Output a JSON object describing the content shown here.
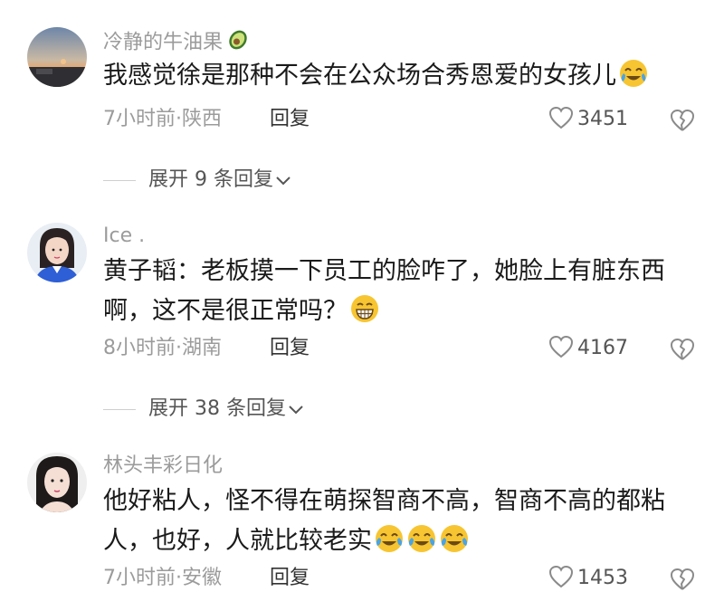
{
  "comments": [
    {
      "username": "冷静的牛油果",
      "username_emoji": "avocado-icon",
      "text": "我感觉徐是那种不会在公众场合秀恩爱的女孩儿",
      "emojis": [
        "crying-laughing-emoji"
      ],
      "time_location": "7小时前·陕西",
      "reply_label": "回复",
      "likes": "3451",
      "expand_label": "展开 9 条回复"
    },
    {
      "username": "Ice .",
      "text_line1": "黄子韬：老板摸一下员工的脸咋了，她脸上有脏东西",
      "text_line2": "啊，这不是很正常吗？",
      "emojis": [
        "grinning-emoji"
      ],
      "time_location": "8小时前·湖南",
      "reply_label": "回复",
      "likes": "4167",
      "expand_label": "展开 38 条回复"
    },
    {
      "username": "林头丰彩日化",
      "text_line1": "他好粘人，怪不得在萌探智商不高，智商不高的都粘",
      "text_line2": "人，也好，人就比较老实",
      "emojis": [
        "tears-of-joy-emoji",
        "tears-of-joy-emoji",
        "tears-of-joy-emoji"
      ],
      "time_location": "7小时前·安徽",
      "reply_label": "回复",
      "likes": "1453"
    }
  ],
  "colors": {
    "meta_gray": "#9b9b9b",
    "text_dark": "#1a1a1a",
    "emoji_yellow": "#f7c531",
    "tear_blue": "#4aa3e6"
  }
}
